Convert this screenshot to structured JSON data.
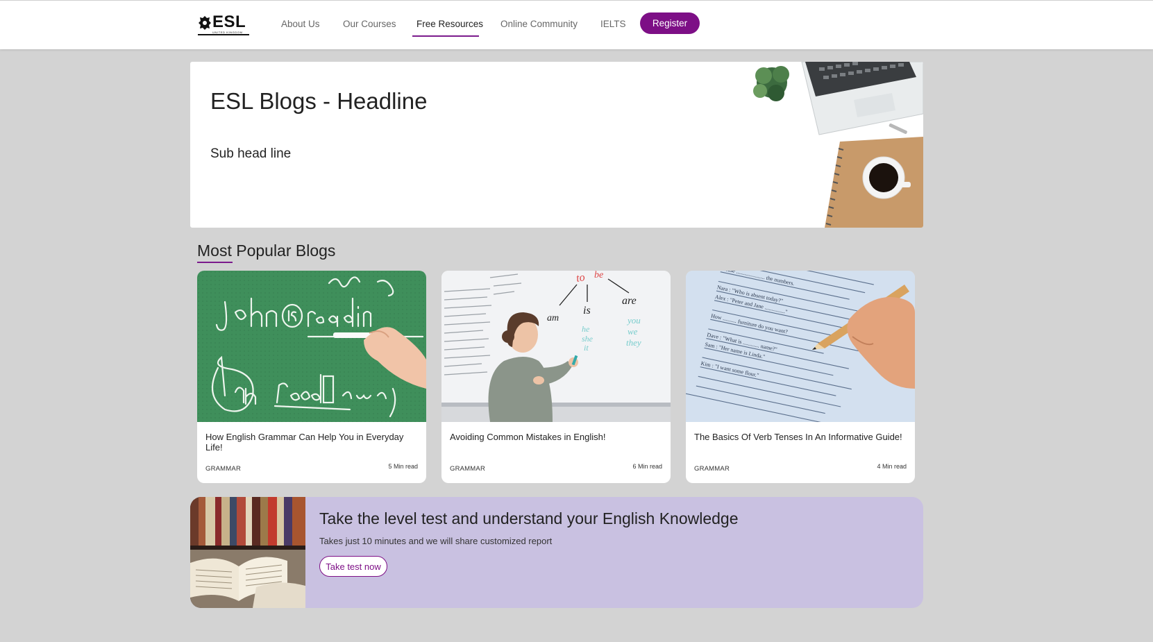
{
  "brand": {
    "logo_text": "ESL",
    "logo_sub": "UNITED KINGDOM"
  },
  "nav": {
    "items": [
      {
        "label": "About Us"
      },
      {
        "label": "Our Courses"
      },
      {
        "label": "Free Resources",
        "active": true
      },
      {
        "label": "Online Community"
      },
      {
        "label": "IELTS"
      }
    ],
    "register_label": "Register"
  },
  "hero": {
    "title": "ESL Blogs - Headline",
    "subtitle": "Sub head line",
    "image": "desk-laptop-coffee-illustration"
  },
  "popular": {
    "title": "Most Popular Blogs",
    "cards": [
      {
        "title": "How English Grammar Can Help You in Everyday Life!",
        "category": "GRAMMAR",
        "read_time": "5 Min read",
        "image": "chalkboard-grammar"
      },
      {
        "title": "Avoiding Common Mistakes in English!",
        "category": "GRAMMAR",
        "read_time": "6 Min read",
        "image": "teacher-whiteboard"
      },
      {
        "title": "The Basics Of Verb Tenses In An Informative Guide!",
        "category": "GRAMMAR",
        "read_time": "4 Min read",
        "image": "worksheet-pencil"
      }
    ]
  },
  "banner": {
    "title": "Take the level test and understand your English Knowledge",
    "subtitle": "Takes just 10 minutes and we will share customized report",
    "button_label": "Take test now",
    "image": "books-library"
  },
  "colors": {
    "accent": "#7d0f86",
    "page_bg": "#d3d3d3",
    "banner_bg": "#c9c1e1",
    "chalkboard": "#3f8f5b"
  }
}
